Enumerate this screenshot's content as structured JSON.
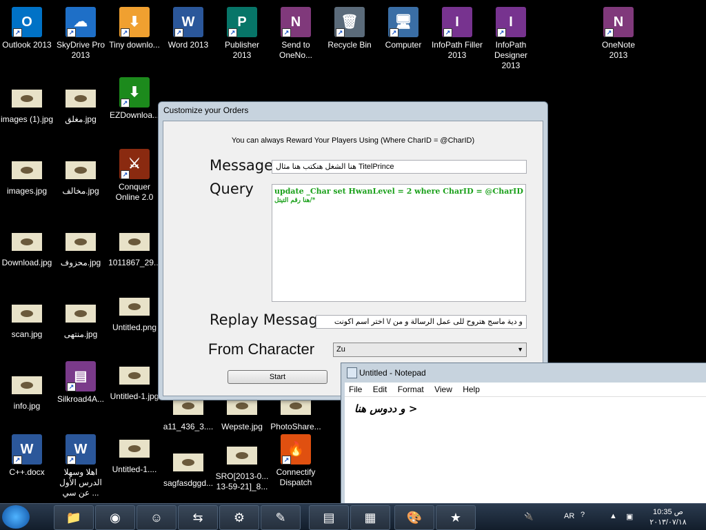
{
  "desktop": {
    "icons": [
      {
        "label": "Outlook 2013",
        "glyph": "O",
        "color": "#0072c6"
      },
      {
        "label": "SkyDrive Pro 2013",
        "glyph": "☁",
        "color": "#1e6fc7"
      },
      {
        "label": "Tiny downlo...",
        "glyph": "⬇",
        "color": "#f0a030"
      },
      {
        "label": "Word 2013",
        "glyph": "W",
        "color": "#2b579a"
      },
      {
        "label": "Publisher 2013",
        "glyph": "P",
        "color": "#077568"
      },
      {
        "label": "Send to OneNo...",
        "glyph": "N",
        "color": "#80397b"
      },
      {
        "label": "Recycle Bin",
        "glyph": "🗑",
        "color": "#5b6b7a"
      },
      {
        "label": "Computer",
        "glyph": "🖥",
        "color": "#3a6ea5"
      },
      {
        "label": "InfoPath Filler 2013",
        "glyph": "I",
        "color": "#77338f"
      },
      {
        "label": "InfoPath Designer 2013",
        "glyph": "I",
        "color": "#77338f"
      },
      {
        "label": "OneNote 2013",
        "glyph": "N",
        "color": "#80397b"
      },
      {
        "label": "images (1).jpg",
        "glyph": "",
        "color": ""
      },
      {
        "label": "مغلق.jpg",
        "glyph": "",
        "color": ""
      },
      {
        "label": "EZDownloa...",
        "glyph": "⬇",
        "color": "#1c8a1c"
      },
      {
        "label": "images.jpg",
        "glyph": "",
        "color": ""
      },
      {
        "label": "مخالف.jpg",
        "glyph": "",
        "color": ""
      },
      {
        "label": "Conquer Online 2.0",
        "glyph": "⚔",
        "color": "#8a2a10"
      },
      {
        "label": "Download.jpg",
        "glyph": "",
        "color": ""
      },
      {
        "label": "محزوف.jpg",
        "glyph": "",
        "color": ""
      },
      {
        "label": "1011867_29...",
        "glyph": "",
        "color": ""
      },
      {
        "label": "scan.jpg",
        "glyph": "",
        "color": ""
      },
      {
        "label": "منتهى.jpg",
        "glyph": "",
        "color": ""
      },
      {
        "label": "Untitled.png",
        "glyph": "",
        "color": ""
      },
      {
        "label": "info.jpg",
        "glyph": "",
        "color": ""
      },
      {
        "label": "Silkroad4A...",
        "glyph": "▤",
        "color": "#7a3a8a"
      },
      {
        "label": "Untitled-1.jpg",
        "glyph": "",
        "color": ""
      },
      {
        "label": "a11_436_3....",
        "glyph": "",
        "color": ""
      },
      {
        "label": "Wepste.jpg",
        "glyph": "",
        "color": ""
      },
      {
        "label": "PhotoShare...",
        "glyph": "",
        "color": ""
      },
      {
        "label": "C++.docx",
        "glyph": "W",
        "color": "#2b579a"
      },
      {
        "label": "اهلا وسهلا الدرس الأول عن سي ...",
        "glyph": "W",
        "color": "#2b579a"
      },
      {
        "label": "Untitled-1....",
        "glyph": "",
        "color": ""
      },
      {
        "label": "sagfasdggd...",
        "glyph": "",
        "color": ""
      },
      {
        "label": "SRO[2013-0... 13-59-21]_8...",
        "glyph": "",
        "color": ""
      },
      {
        "label": "Connectify Dispatch",
        "glyph": "🔥",
        "color": "#e05010"
      }
    ]
  },
  "window": {
    "title": "Customize your Orders",
    "hint": "You can always Reward Your Players Using (Where CharID = @CharID)",
    "message_label": "Message",
    "message_value": "هنا الشغل هنكتب هنا مثال TitelPrince",
    "query_label": "Query",
    "query_line1": "update _Char set HwanLevel = 2 where CharID = @CharID",
    "query_line2": "هنا رقم التيتل/*",
    "replay_label": "Replay Message",
    "replay_value": "و دية ماسج هتروح للى عمل الرسالة و من /\\ اختر اسم اكونت",
    "from_label": "From Character",
    "from_value": "Zu",
    "start_label": "Start"
  },
  "notepad": {
    "title": "Untitled - Notepad",
    "menu": [
      "File",
      "Edit",
      "Format",
      "View",
      "Help"
    ],
    "text": "و ددوس هنا >"
  },
  "taskbar": {
    "time": "10:35 ص",
    "date": "٢٠١٣/٠٧/١٨",
    "lang": "AR"
  }
}
